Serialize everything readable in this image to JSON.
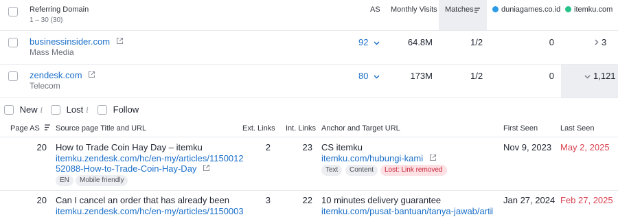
{
  "header": {
    "referring_domain": "Referring Domain",
    "range": "1 – 30 (30)",
    "as": "AS",
    "monthly_visits": "Monthly Visits",
    "matches": "Matches",
    "competitor1": "duniagames.co.id",
    "competitor1_color": "#2d9ce6",
    "competitor2": "itemku.com",
    "competitor2_color": "#27c28a"
  },
  "domains": [
    {
      "name": "businessinsider.com",
      "category": "Mass Media",
      "as": "92",
      "visits": "64.8M",
      "matches": "1/2",
      "c1": "0",
      "c2": "3"
    },
    {
      "name": "zendesk.com",
      "category": "Telecom",
      "as": "80",
      "visits": "173M",
      "matches": "1/2",
      "c1": "0",
      "c2": "1,121"
    }
  ],
  "filters": {
    "new": "New",
    "lost": "Lost",
    "follow": "Follow",
    "info": "i"
  },
  "backlinks_header": {
    "page_as": "Page AS",
    "source": "Source page Title and URL",
    "ext_links": "Ext. Links",
    "int_links": "Int. Links",
    "anchor": "Anchor and Target URL",
    "first_seen": "First Seen",
    "last_seen": "Last Seen"
  },
  "backlinks": [
    {
      "page_as": "20",
      "title": "How to Trade Coin Hay Day – itemku",
      "url_line1": "itemku.zendesk.com/hc/en-my/articles/1150012",
      "url_line2": "52088-How-to-Trade-Coin-Hay-Day",
      "tags": [
        "EN",
        "Mobile friendly"
      ],
      "ext": "2",
      "int": "23",
      "anchor": "CS itemku",
      "target": "itemku.com/hubungi-kami",
      "anchor_tags": [
        "Text",
        "Content"
      ],
      "status": "Lost: Link removed",
      "first_seen": "Nov 9, 2023",
      "last_seen": "May 2, 2025"
    },
    {
      "page_as": "20",
      "title": "Can I cancel an order that has already been paid...",
      "url_line1": "itemku.zendesk.com/hc/en-my/articles/1150003",
      "ext": "3",
      "int": "22",
      "anchor": "10 minutes delivery guarantee",
      "target": "itemku.com/pusat-bantuan/tanya-jawab/artikel/t",
      "first_seen": "Jan 27, 2024",
      "last_seen": "Feb 27, 2025"
    }
  ]
}
